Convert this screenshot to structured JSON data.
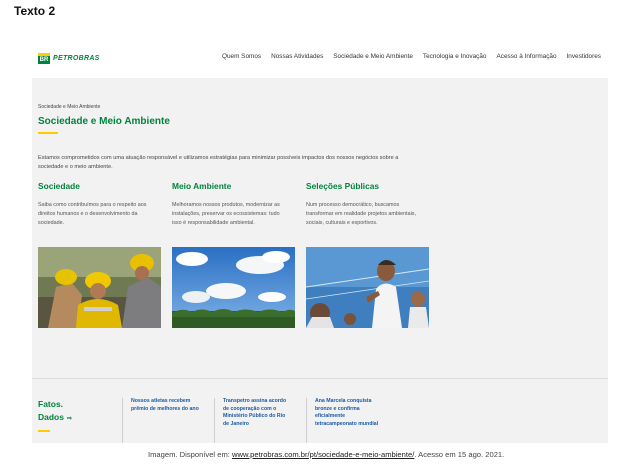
{
  "doc_label": "Texto 2",
  "header": {
    "logo_text": "PETROBRAS",
    "logo_mark": "BR",
    "nav": [
      "Quem Somos",
      "Nossas Atividades",
      "Sociedade e Meio Ambiente",
      "Tecnologia e Inovação",
      "Acesso à Informação",
      "Investidores"
    ]
  },
  "page": {
    "breadcrumb": "Sociedade e Meio Ambiente",
    "title": "Sociedade e Meio Ambiente",
    "intro_line1": "Estamos comprometidos com uma atuação responsável e utilizamos estratégias para minimizar possíveis impactos dos nossos negócios sobre a",
    "intro_line2": "sociedade e o meio ambiente."
  },
  "columns": [
    {
      "title": "Sociedade",
      "line1": "Saiba como contribuímos para o respeito aos",
      "line2": "direitos humanos e o desenvolvimento da",
      "line3": "sociedade.",
      "image": "workers-with-yellow-helmets"
    },
    {
      "title": "Meio Ambiente",
      "line1": "Melhoramos nossos produtos, modernizar as",
      "line2": "instalações, preservar os ecossistemas: tudo",
      "line3": "isso é responsabilidade ambiental.",
      "image": "sky-and-forest"
    },
    {
      "title": "Seleções Públicas",
      "line1": "Num processo democrático, buscamos",
      "line2": "transformar em realidade projetos ambientais,",
      "line3": "sociais, culturais e esportivos.",
      "image": "children-playing-sport"
    }
  ],
  "fatos": {
    "line1": "Fatos.",
    "line2": "Dados",
    "arrow": "⇨"
  },
  "news": [
    {
      "line1": "Nossos atletas recebem",
      "line2": "prêmio de melhores do ano",
      "line3": "",
      "line4": ""
    },
    {
      "line1": "Transpetro assina acordo",
      "line2": "de cooperação com o",
      "line3": "Ministério Público do Rio",
      "line4": "de Janeiro"
    },
    {
      "line1": "Ana Marcela conquista",
      "line2": "bronze e confirma",
      "line3": "eficialmente",
      "line4": "tetracampeonato mundial"
    }
  ],
  "caption": {
    "prefix": "Imagem. Disponível em: ",
    "link": "www.petrobras.com.br/pt/sociedade-e-meio-ambiente/",
    "suffix": ". Acesso em 15 ago. 2021."
  },
  "colors": {
    "brand_green": "#00843d",
    "brand_yellow": "#ffcc00",
    "news_blue": "#1a5aa6"
  }
}
